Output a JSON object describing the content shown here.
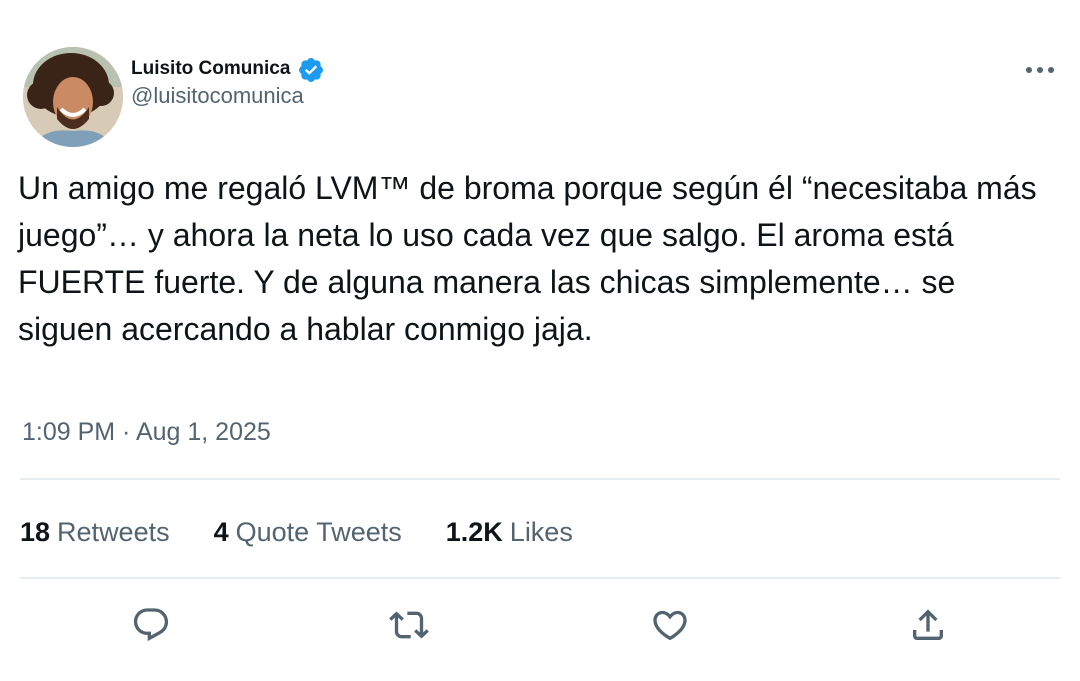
{
  "author": {
    "name": "Luisito Comunica",
    "handle": "@luisitocomunica",
    "verified": true
  },
  "tweet": {
    "text": "Un amigo me regaló LVM™ de broma porque según él “necesitaba más juego”… y ahora la neta lo uso cada vez que salgo. El aroma está FUERTE fuerte. Y de alguna manera las chicas simplemente… se siguen acercando a hablar conmigo jaja.",
    "timestamp": "1:09 PM · Aug 1, 2025"
  },
  "stats": {
    "retweets": {
      "count": "18",
      "label": "Retweets"
    },
    "quote_tweets": {
      "count": "4",
      "label": "Quote Tweets"
    },
    "likes": {
      "count": "1.2K",
      "label": "Likes"
    }
  },
  "actions": {
    "reply_icon": "reply-icon",
    "retweet_icon": "retweet-icon",
    "like_icon": "heart-icon",
    "share_icon": "share-icon"
  },
  "colors": {
    "text_primary": "#0f1419",
    "text_secondary": "#536471",
    "verified_blue": "#1d9bf0",
    "divider": "#e6ecf0"
  }
}
